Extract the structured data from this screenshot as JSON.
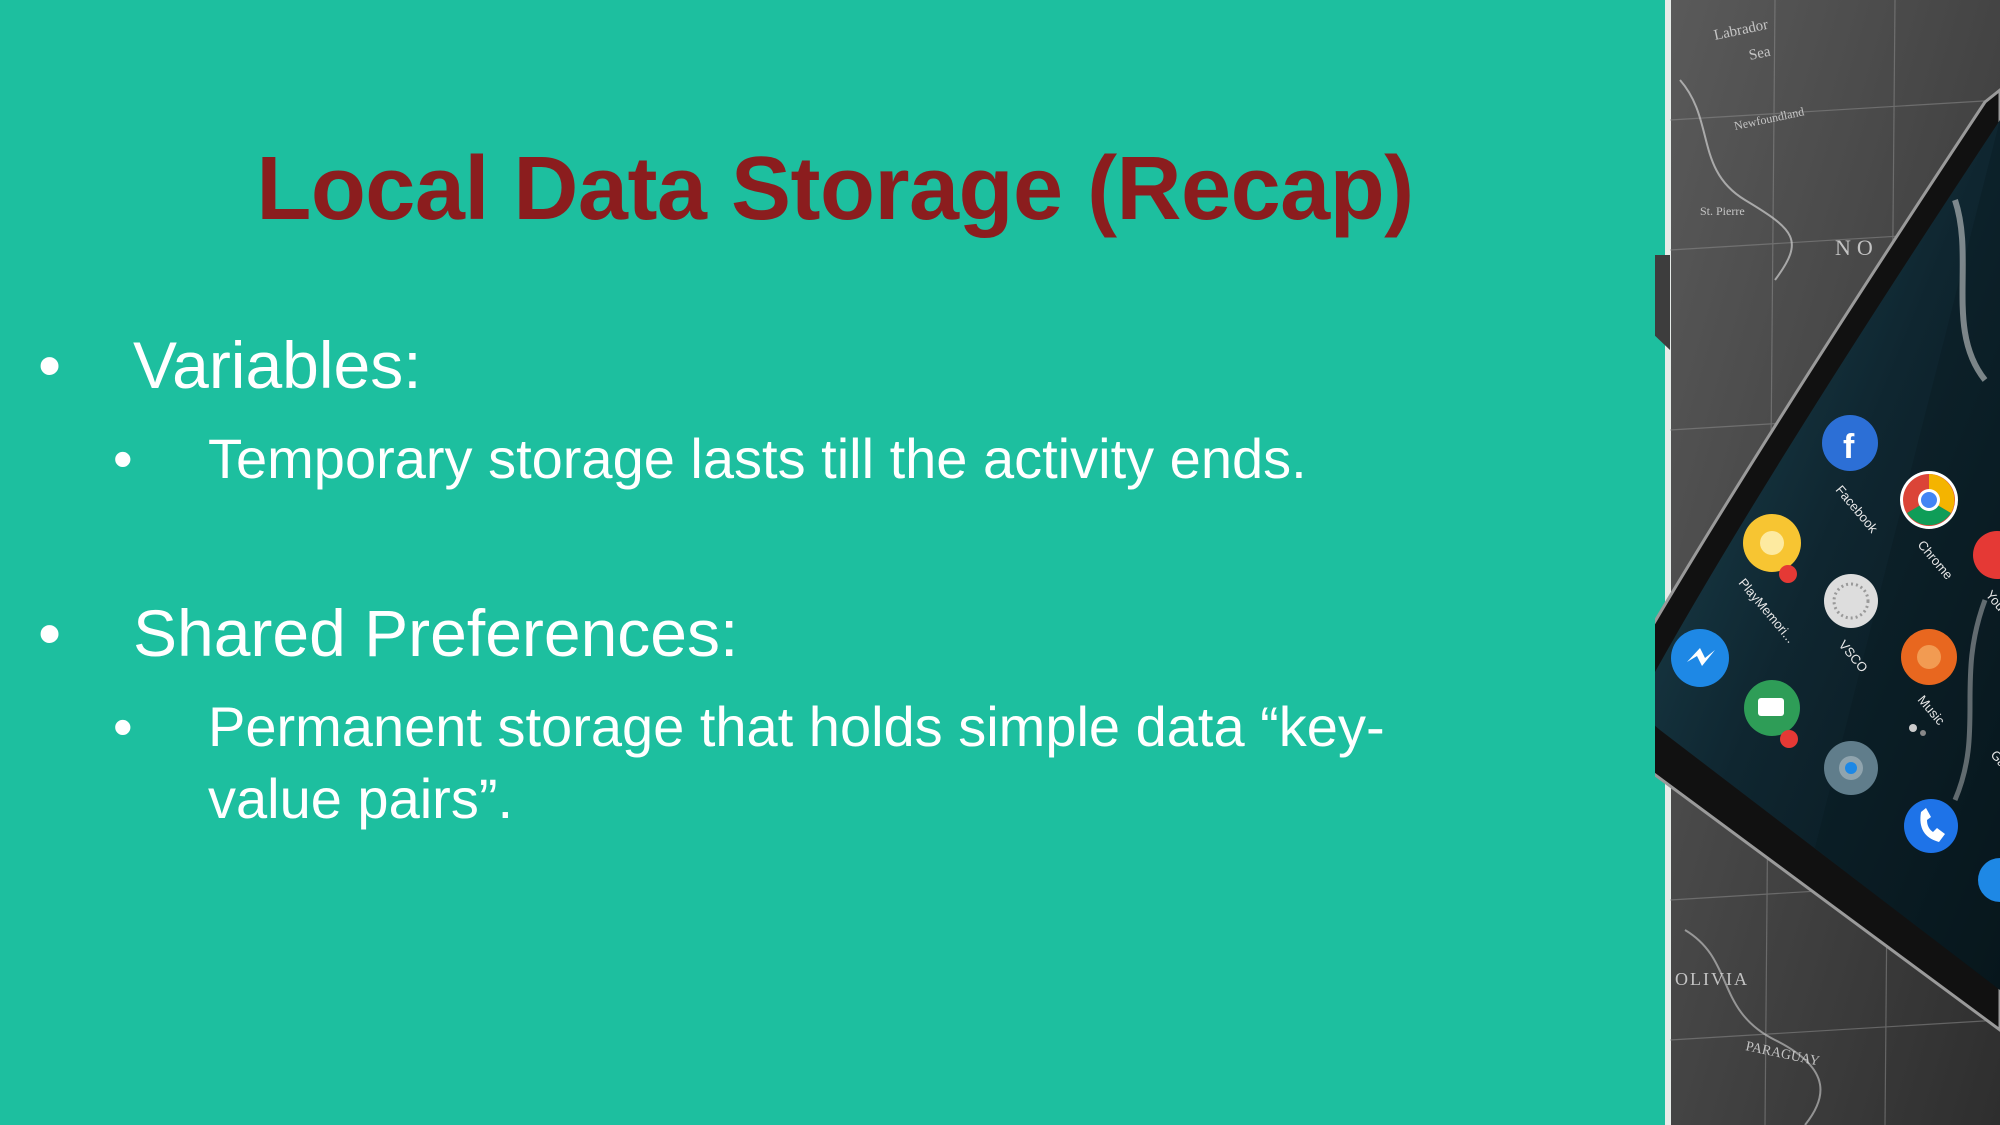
{
  "slide": {
    "title": "Local Data Storage (Recap)",
    "bullet_char": "•",
    "bullets": [
      {
        "label": "Variables:",
        "sub": [
          "Temporary storage lasts till the activity ends."
        ]
      },
      {
        "label": "Shared Preferences:",
        "sub": [
          "Permanent storage that holds simple data “key-value pairs”."
        ]
      }
    ]
  },
  "colors": {
    "background": "#1dbf9f",
    "title": "#8b1d1e",
    "text": "#ffffff"
  },
  "phone": {
    "map_labels": [
      "Labrador Sea",
      "Island of Newfoundland",
      "St. Pierre",
      "NO",
      "OLIVIA",
      "PARAGUAY"
    ],
    "apps": [
      "Facebook",
      "Chrome",
      "YouTube",
      "PlayMemori...",
      "VSCO",
      "Music",
      "Gallery"
    ],
    "icons": [
      "facebook-icon",
      "chrome-icon",
      "youtube-icon",
      "playmemories-icon",
      "vsco-icon",
      "music-icon",
      "gallery-icon",
      "messenger-icon",
      "hangouts-icon",
      "camera-icon",
      "phone-icon"
    ]
  }
}
